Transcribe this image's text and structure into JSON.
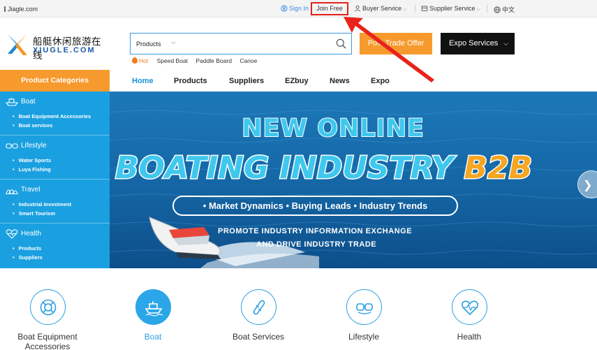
{
  "topbar": {
    "site": "Jiagle.com",
    "sign_in": "Sign In",
    "join_free": "Join Free",
    "buyer_service": "Buyer Service",
    "supplier_service": "Supplier Service",
    "language": "中文"
  },
  "logo": {
    "cn": "船艇休闲旅游在线",
    "en": "XIUGLE.COM"
  },
  "search": {
    "category": "Products",
    "placeholder": ""
  },
  "header_buttons": {
    "trade_offer": "Post Trade Offer",
    "expo_services": "Expo Services"
  },
  "hot": {
    "label": "Hot",
    "keywords": [
      "Speed Boat",
      "Paddle Board",
      "Canoe"
    ]
  },
  "nav": {
    "categories_title": "Product Categories",
    "items": [
      "Home",
      "Products",
      "Suppliers",
      "EZbuy",
      "News",
      "Expo"
    ]
  },
  "sidebar": [
    {
      "title": "Boat",
      "icon": "boat-icon",
      "subs": [
        "Boat Equipment Accessories",
        "Boat services"
      ]
    },
    {
      "title": "Lifestyle",
      "icon": "goggles-icon",
      "subs": [
        "Water Sports",
        "Luya Fishing"
      ]
    },
    {
      "title": "Travel",
      "icon": "opera-house-icon",
      "subs": [
        "Industrial Investment",
        "Smart Tourism"
      ]
    },
    {
      "title": "Health",
      "icon": "heart-icon",
      "subs": [
        "Products",
        "Suppliers"
      ]
    }
  ],
  "banner": {
    "title1": "NEW ONLINE",
    "title2": "BOATING INDUSTRY",
    "title2_highlight": "B2B",
    "pill": "• Market Dynamics • Buying Leads • Industry Trends",
    "line1": "PROMOTE INDUSTRY INFORMATION EXCHANGE",
    "line2": "AND DRIVE INDUSTRY TRADE"
  },
  "categories": [
    {
      "label": "Boat Equipment Accessories",
      "icon": "lifebuoy-icon"
    },
    {
      "label": "Boat",
      "icon": "boat-icon"
    },
    {
      "label": "Boat Services",
      "icon": "tools-icon"
    },
    {
      "label": "Lifestyle",
      "icon": "goggles-icon"
    },
    {
      "label": "Health",
      "icon": "heart-pulse-icon"
    }
  ],
  "colors": {
    "brand_blue": "#1aa0e0",
    "brand_orange": "#f79a2e",
    "highlight_red": "#e2231a"
  }
}
